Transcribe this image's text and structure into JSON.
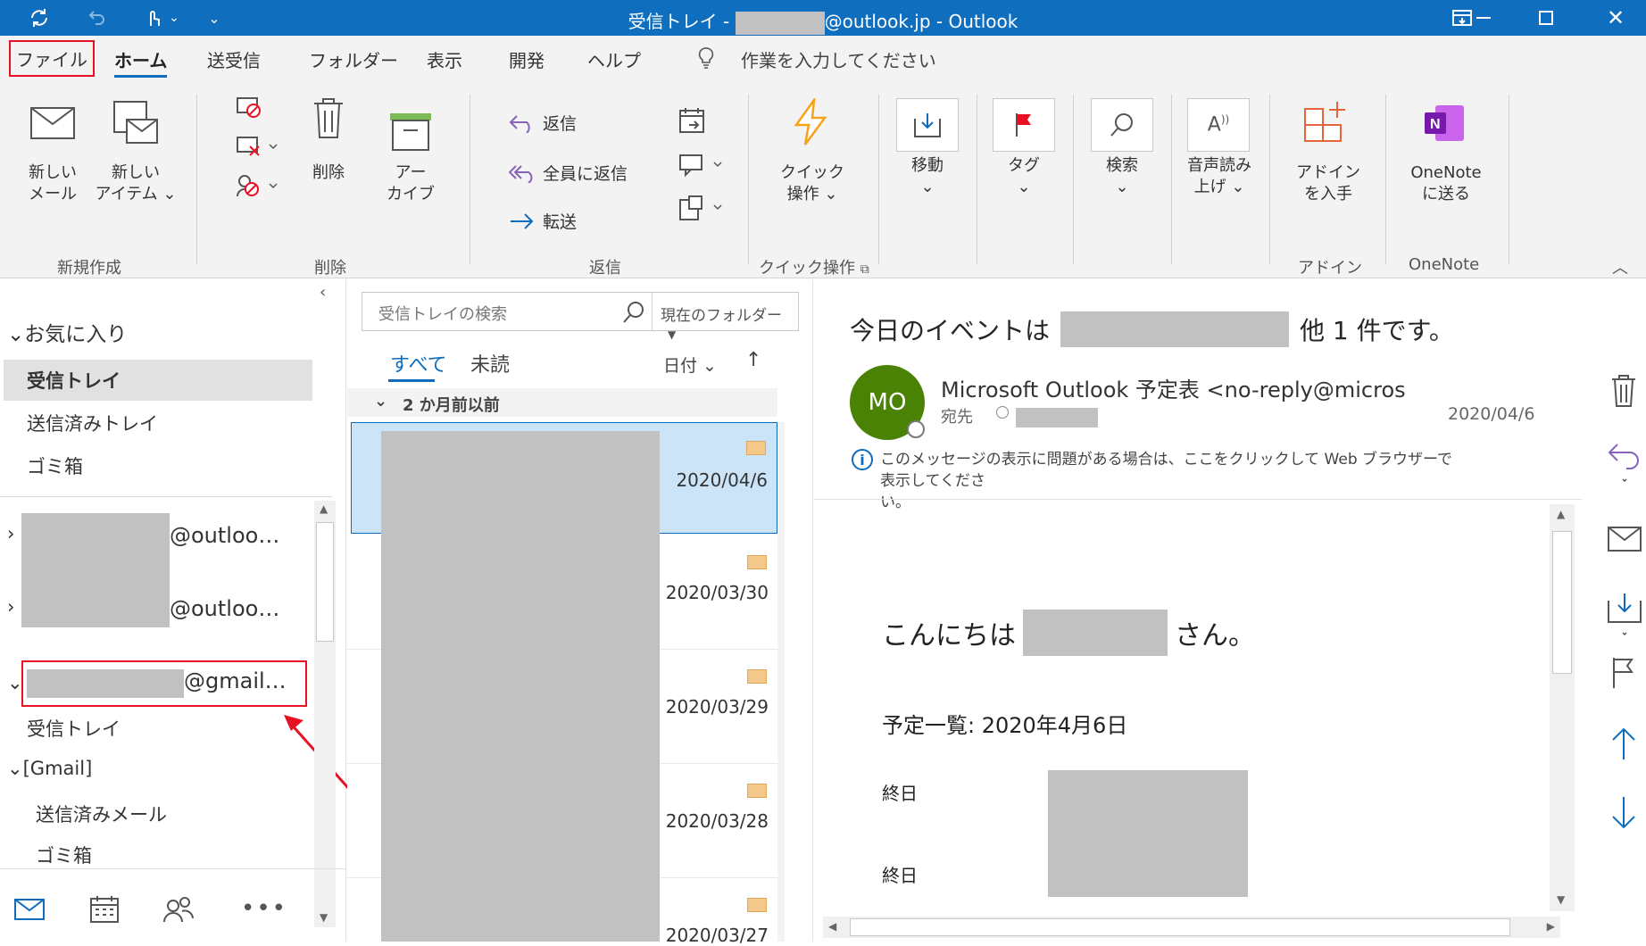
{
  "window": {
    "title_prefix": "受信トレイ -",
    "title_suffix": "@outlook.jp  -  Outlook"
  },
  "tabs": [
    "ファイル",
    "ホーム",
    "送受信",
    "フォルダー",
    "表示",
    "開発",
    "ヘルプ"
  ],
  "tell_me": "作業を入力してください",
  "ribbon": {
    "new_mail": [
      "新しい",
      "メール"
    ],
    "new_item": [
      "新しい",
      "アイテム ⌄"
    ],
    "group_new": "新規作成",
    "delete": "削除",
    "archive": [
      "アー",
      "カイブ"
    ],
    "group_delete": "削除",
    "reply": "返信",
    "reply_all": "全員に返信",
    "forward": "転送",
    "group_respond": "返信",
    "quick_steps": [
      "クイック",
      "操作 ⌄"
    ],
    "group_quick": "クイック操作",
    "move": "移動",
    "tags": "タグ",
    "find": "検索",
    "read_aloud": [
      "音声読み",
      "上げ ⌄"
    ],
    "addins": [
      "アドイン",
      "を入手"
    ],
    "group_addins": "アドイン",
    "onenote": [
      "OneNote",
      "に送る"
    ],
    "group_onenote": "OneNote"
  },
  "nav": {
    "favorites": "お気に入り",
    "inbox": "受信トレイ",
    "sent": "送信済みトレイ",
    "trash": "ゴミ箱",
    "account1": "@outloo…",
    "account2": "@outloo…",
    "account3": "@gmail…",
    "gmail_inbox": "受信トレイ",
    "gmail_folder": "[Gmail]",
    "gmail_sent": "送信済みメール",
    "gmail_trash": "ゴミ箱"
  },
  "list": {
    "search_placeholder": "受信トレイの検索",
    "scope": "現在のフォルダー",
    "filter_all": "すべて",
    "filter_unread": "未読",
    "sort": "日付",
    "group_header": "2 か月前以前",
    "dates": [
      "2020/04/6",
      "2020/03/30",
      "2020/03/29",
      "2020/03/28",
      "2020/03/27"
    ]
  },
  "reading": {
    "subject_prefix": "今日のイベントは",
    "subject_suffix": "他 1 件です。",
    "avatar": "MO",
    "sender": "Microsoft Outlook 予定表 <no-reply@micros",
    "to_label": "宛先",
    "date": "2020/04/6",
    "info": "このメッセージの表示に問題がある場合は、ここをクリックして Web ブラウザーで表示してくださ",
    "info2": "い。",
    "greeting_prefix": "こんにちは",
    "greeting_suffix": "さん。",
    "schedule": "予定一覧: 2020年4月6日",
    "allday1": "終日",
    "allday2": "終日"
  },
  "colors": {
    "titlebar": "#106ebe",
    "accent": "#0f6cbd",
    "selected": "#cce4f7",
    "highlight_red": "#e81123",
    "avatar": "#498205"
  }
}
